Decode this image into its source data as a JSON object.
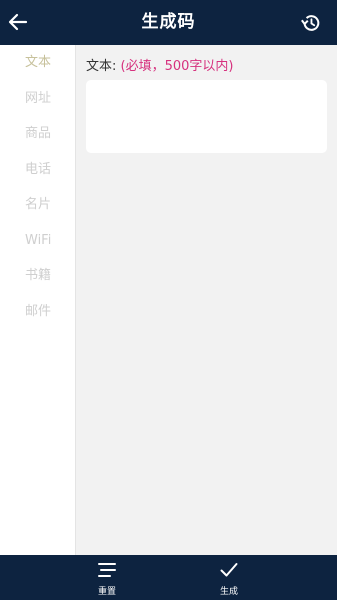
{
  "header": {
    "title": "生成码",
    "back_icon": "back-arrow-icon",
    "history_icon": "history-icon"
  },
  "sidebar": {
    "items": [
      {
        "label": "文本",
        "active": true
      },
      {
        "label": "网址",
        "active": false
      },
      {
        "label": "商品",
        "active": false
      },
      {
        "label": "电话",
        "active": false
      },
      {
        "label": "名片",
        "active": false
      },
      {
        "label": "WiFi",
        "active": false
      },
      {
        "label": "书籍",
        "active": false
      },
      {
        "label": "邮件",
        "active": false
      }
    ]
  },
  "main": {
    "field_label": "文本:",
    "field_hint": "(必填，500字以内)",
    "text_value": ""
  },
  "footer": {
    "reset_label": "重置",
    "generate_label": "生成"
  },
  "colors": {
    "bar_bg": "#0d2340",
    "active_item": "#c7c19b",
    "inactive_item": "#cfcfcf",
    "required_hint": "#d6317e",
    "content_bg": "#f2f2f2"
  }
}
